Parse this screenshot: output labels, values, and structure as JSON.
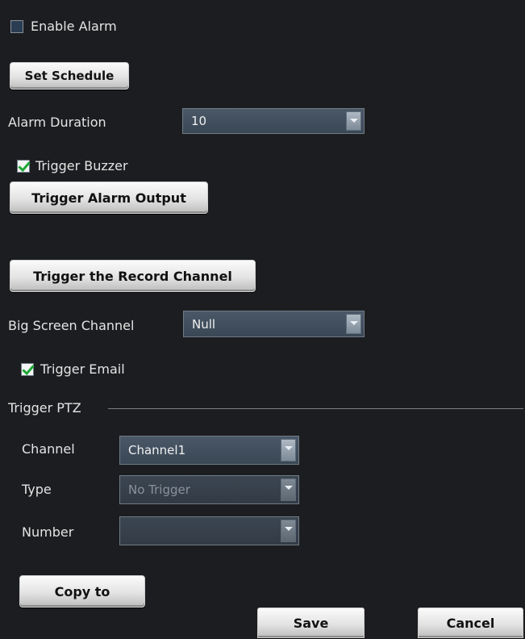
{
  "enable_alarm": {
    "label": "Enable Alarm",
    "checked": false
  },
  "set_schedule": {
    "label": "Set Schedule"
  },
  "alarm_duration": {
    "label": "Alarm Duration",
    "value": "10"
  },
  "trigger_buzzer": {
    "label": "Trigger Buzzer",
    "checked": true
  },
  "trigger_alarm_output": {
    "label": "Trigger Alarm Output"
  },
  "trigger_record_channel": {
    "label": "Trigger the Record Channel"
  },
  "big_screen_channel": {
    "label": "Big Screen Channel",
    "value": "Null"
  },
  "trigger_email": {
    "label": "Trigger Email",
    "checked": true
  },
  "trigger_ptz": {
    "title": "Trigger PTZ",
    "channel": {
      "label": "Channel",
      "value": "Channel1"
    },
    "type": {
      "label": "Type",
      "value": "No Trigger"
    },
    "number": {
      "label": "Number",
      "value": ""
    }
  },
  "buttons": {
    "copy_to": "Copy to",
    "save": "Save",
    "cancel": "Cancel"
  },
  "colors": {
    "background": "#1c1d20",
    "check_green": "#1ea835",
    "select_bg": "#44515f"
  }
}
